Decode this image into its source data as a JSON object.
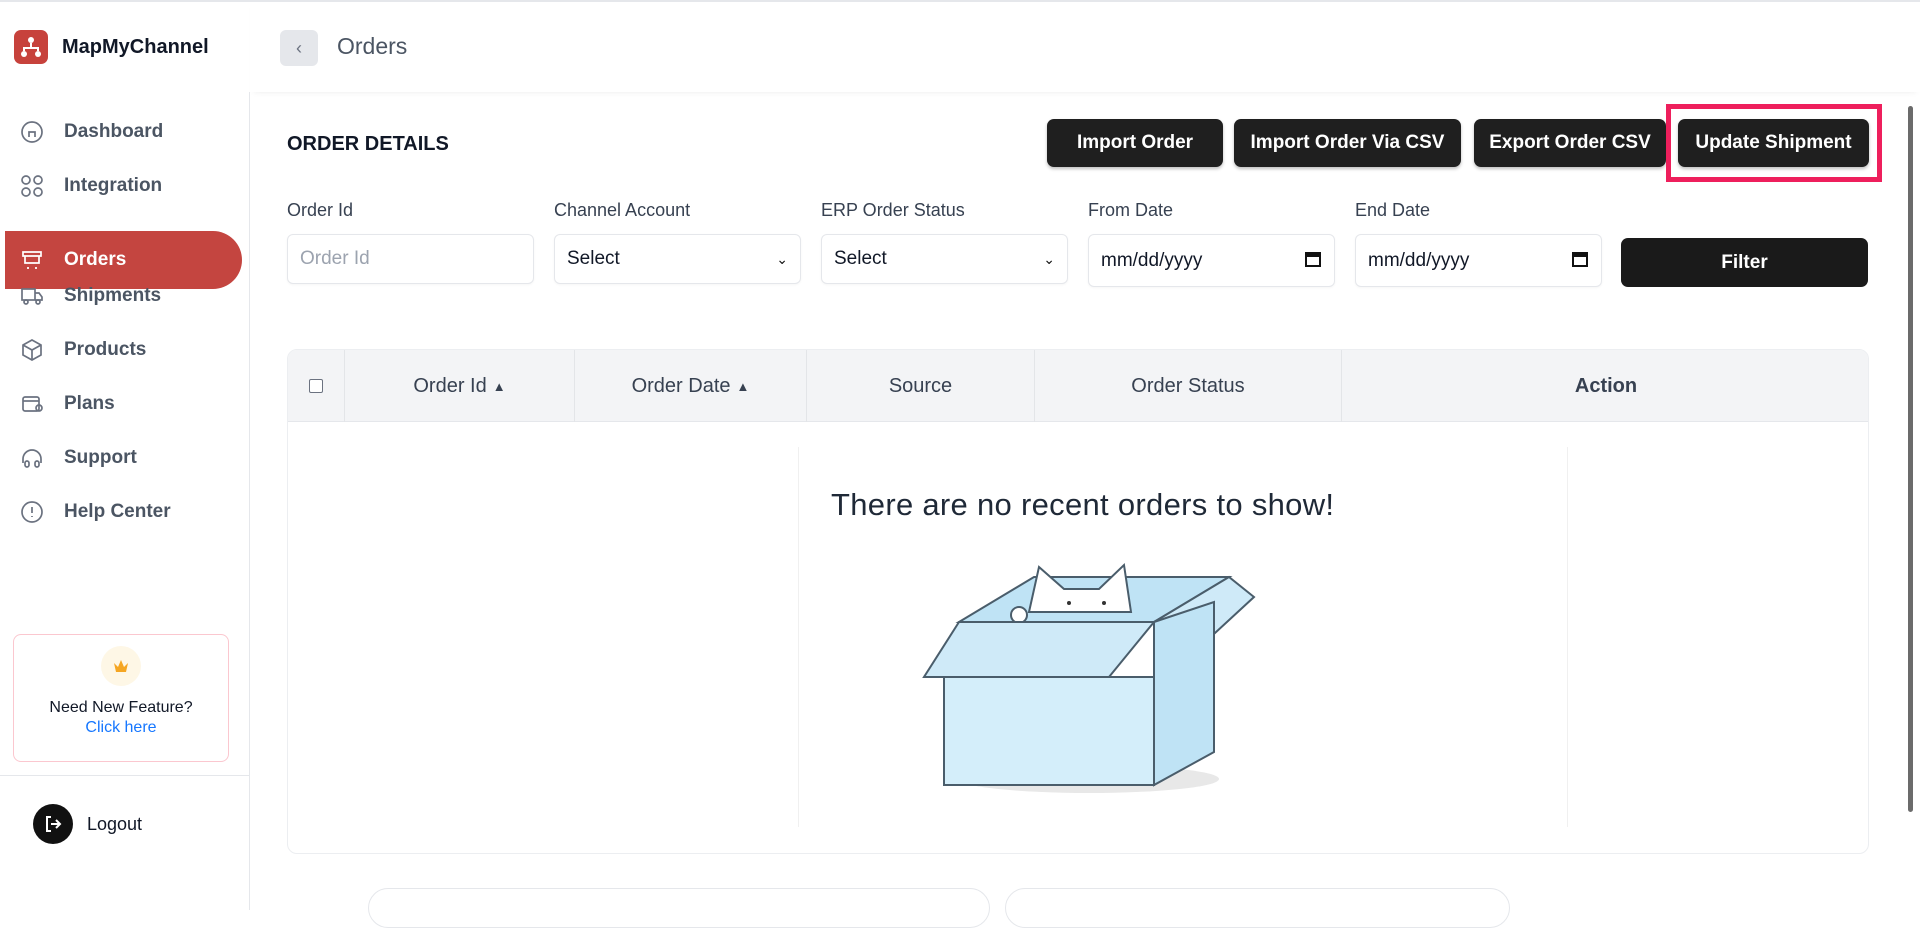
{
  "brand": {
    "name": "MapMyChannel",
    "color": "#c7423c"
  },
  "header": {
    "back_icon": "chevron-left-icon",
    "title": "Orders"
  },
  "sidebar": {
    "items": [
      {
        "label": "Dashboard",
        "icon": "home-icon",
        "active": false
      },
      {
        "label": "Integration",
        "icon": "grid-icon",
        "active": false
      },
      {
        "label": "Orders",
        "icon": "cart-icon",
        "active": true
      },
      {
        "label": "Shipments",
        "icon": "truck-icon",
        "active": false
      },
      {
        "label": "Products",
        "icon": "box-icon",
        "active": false
      },
      {
        "label": "Plans",
        "icon": "wallet-icon",
        "active": false
      },
      {
        "label": "Support",
        "icon": "headphones-icon",
        "active": false
      },
      {
        "label": "Help Center",
        "icon": "info-icon",
        "active": false
      }
    ],
    "feature_card": {
      "title": "Need New Feature?",
      "link": "Click here"
    },
    "logout": "Logout"
  },
  "main": {
    "section_title": "ORDER DETAILS",
    "actions": {
      "import_order": "Import Order",
      "import_csv": "Import Order Via CSV",
      "export_csv": "Export Order CSV",
      "update_shipment": "Update Shipment"
    },
    "filters": {
      "order_id_label": "Order Id",
      "order_id_placeholder": "Order Id",
      "channel_label": "Channel Account",
      "channel_value": "Select",
      "erp_label": "ERP Order Status",
      "erp_value": "Select",
      "from_label": "From Date",
      "from_value": "mm/dd/yyyy",
      "end_label": "End Date",
      "end_value": "mm/dd/yyyy",
      "filter_button": "Filter"
    },
    "table": {
      "columns": [
        "Order Id",
        "Order Date",
        "Source",
        "Order Status",
        "Action"
      ],
      "empty_message": "There are no recent orders to show!"
    }
  },
  "colors": {
    "accent": "#c44540",
    "highlight": "#ee1f5c",
    "link": "#1677ff",
    "button": "#1f1f1f"
  }
}
